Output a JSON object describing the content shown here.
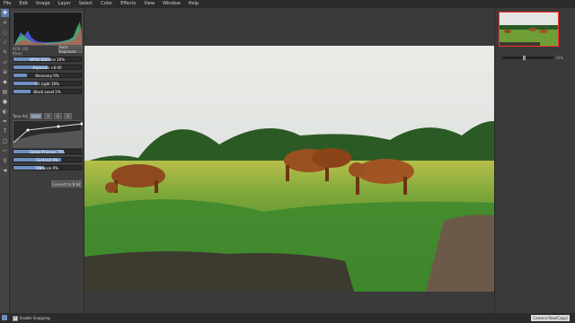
{
  "menu": [
    "File",
    "Edit",
    "Image",
    "Layer",
    "Select",
    "Color",
    "Effects",
    "View",
    "Window",
    "Help"
  ],
  "tools": [
    "move-icon",
    "crop-icon",
    "lasso-icon",
    "wand-icon",
    "brush-icon",
    "eraser-icon",
    "clone-icon",
    "fill-icon",
    "gradient-icon",
    "blur-icon",
    "dodge-icon",
    "pen-icon",
    "text-icon",
    "shape-icon",
    "eyedropper-icon",
    "zoom-icon",
    "hand-icon"
  ],
  "panel": {
    "stats": [
      "RGB 100",
      "Mean",
      "Std Dev"
    ],
    "auto_button": "Auto Exposure",
    "sliders": [
      {
        "label": "White Balance 10%",
        "value": 0.55
      },
      {
        "label": "Exposure +0.00",
        "value": 0.5
      },
      {
        "label": "Recovery 0%",
        "value": 0.2
      },
      {
        "label": "Fill Light 10%",
        "value": 0.35
      },
      {
        "label": "Black Level 2%",
        "value": 0.25
      }
    ],
    "tone": {
      "label": "Tone Adj",
      "modes": [
        "Lum",
        "R",
        "G",
        "B"
      ]
    },
    "sliders2": [
      {
        "label": "Global Process 75%",
        "value": 0.75
      },
      {
        "label": "Contrast 0%",
        "value": 0.7
      },
      {
        "label": "Vibrance 0%",
        "value": 0.45
      }
    ],
    "convert_button": "Convert to 8 bit"
  },
  "navigator": {
    "zoom_label": "33%"
  },
  "status": {
    "snap_label": "Enable Snapping",
    "layer_name": "Camera Raw(Copy)"
  }
}
